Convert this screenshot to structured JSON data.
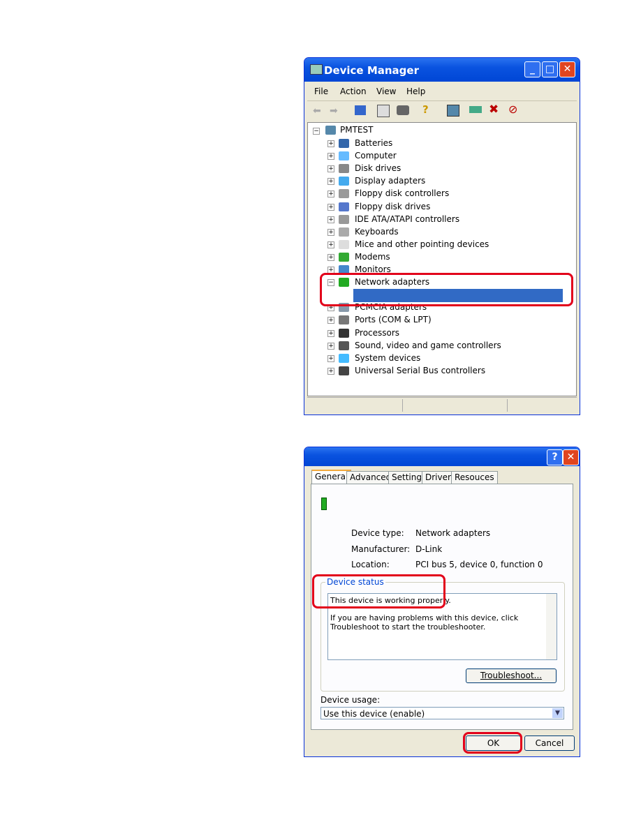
{
  "device_manager": {
    "title": "Device Manager",
    "menu": [
      "File",
      "Action",
      "View",
      "Help"
    ],
    "root": "PMTEST",
    "items": [
      "Batteries",
      "Computer",
      "Disk drives",
      "Display adapters",
      "Floppy disk controllers",
      "Floppy disk drives",
      "IDE ATA/ATAPI controllers",
      "Keyboards",
      "Mice and other pointing devices",
      "Modems",
      "Monitors",
      "Network adapters",
      "",
      "PCMCIA adapters",
      "Ports (COM & LPT)",
      "Processors",
      "Sound, video and game controllers",
      "System devices",
      "Universal Serial Bus controllers"
    ],
    "highlight_color": "#316ac5"
  },
  "properties": {
    "tabs": [
      "General",
      "Advanced",
      "Settings",
      "Driver",
      "Resouces"
    ],
    "device_type_label": "Device type:",
    "device_type": "Network adapters",
    "manufacturer_label": "Manufacturer:",
    "manufacturer": "D-Link",
    "location_label": "Location:",
    "location": "PCI bus 5, device 0, function 0",
    "status_group": "Device status",
    "status_line1": "This device is working properly.",
    "status_line2": "If you are having problems with this device, click Troubleshoot to start the troubleshooter.",
    "troubleshoot": "Troubleshoot...",
    "usage_label": "Device usage:",
    "usage_value": "Use this device (enable)",
    "ok": "OK",
    "cancel": "Cancel"
  },
  "annotation_color": "#e2001a"
}
